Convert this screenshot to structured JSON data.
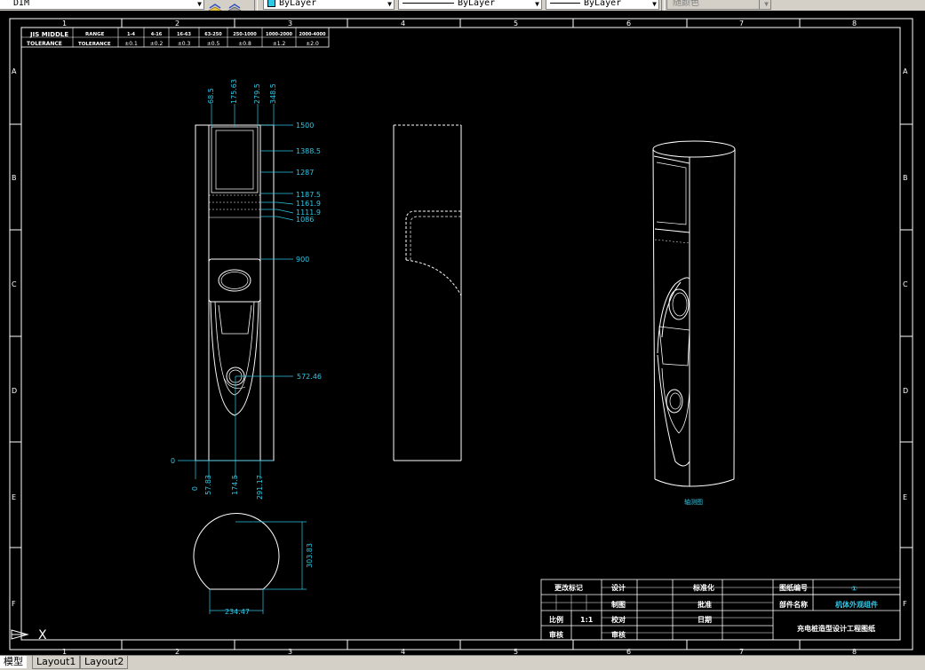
{
  "toolbar": {
    "layer_combo": "DIM",
    "color_combo": "ByLayer",
    "linetype_combo": "ByLayer",
    "lineweight_combo": "ByLayer",
    "plotstyle_combo": "随颜色"
  },
  "frame": {
    "columns": [
      "1",
      "2",
      "3",
      "4",
      "5",
      "6",
      "7",
      "8"
    ],
    "rows": [
      "A",
      "B",
      "C",
      "D",
      "E",
      "F"
    ]
  },
  "tolerance_table": {
    "row1_label": "JIS MIDDLE",
    "row2_label": "TOLERANCE",
    "range_header": "RANGE",
    "tol_header": "TOLERANCE",
    "ranges": [
      "1-4",
      "4-16",
      "16-63",
      "63-250",
      "250-1000",
      "1000-2000",
      "2000-4000"
    ],
    "tolerances": [
      "±0.1",
      "±0.2",
      "±0.3",
      "±0.5",
      "±0.8",
      "±1.2",
      "±2.0"
    ]
  },
  "dimensions": {
    "top": [
      "68.5",
      "175.63",
      "279.5",
      "348.5"
    ],
    "right": [
      "1500",
      "1388.5",
      "1287",
      "1187.5",
      "1161.9",
      "1111.9",
      "1086",
      "900",
      "572.46"
    ],
    "origin": "0",
    "bottom": [
      "0",
      "57.83",
      "174.5",
      "291.17"
    ],
    "plan_height": "303.83",
    "plan_width": "234.47"
  },
  "iso_label": "轴测图",
  "title_block": {
    "rev_mark": "更改标记",
    "design": "设计",
    "standard": "标准化",
    "drawing_no_label": "图纸编号",
    "drawing_no_value": "①",
    "draw": "制图",
    "approve": "批准",
    "part_name_label": "部件名称",
    "part_name_value": "机体外观组件",
    "scale_label": "比例",
    "scale_value": "1:1",
    "check": "校对",
    "date": "日期",
    "review": "审核",
    "audit": "审核",
    "project_title": "充电桩造型设计工程图纸"
  },
  "tabs": {
    "model": "模型",
    "layout1": "Layout1",
    "layout2": "Layout2"
  },
  "ucs": {
    "x_axis": "X"
  },
  "colors": {
    "dimension": "#2ec7e6",
    "drawing": "#ffffff",
    "background": "#000000"
  }
}
